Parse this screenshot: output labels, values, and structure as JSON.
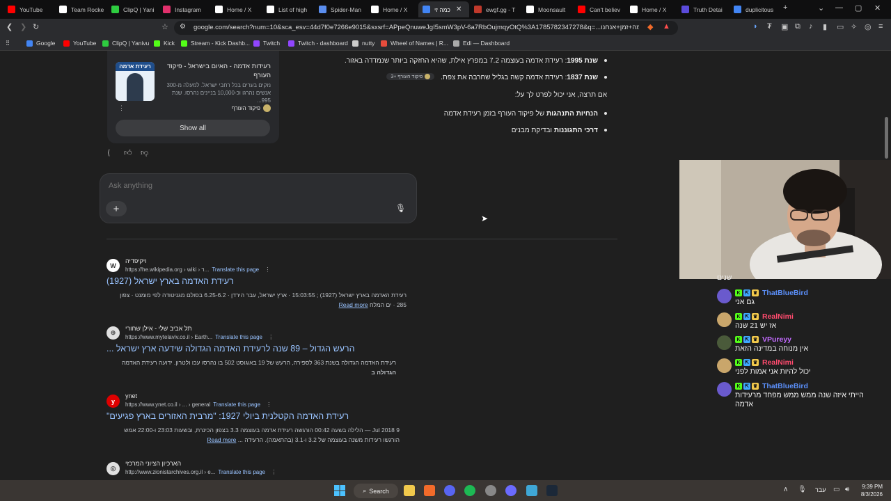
{
  "tabs": [
    {
      "title": "YouTube",
      "icon": "youtube-icon",
      "color": "#ff0000"
    },
    {
      "title": "Team Rocke",
      "icon": "docs-icon",
      "color": "#ffffff"
    },
    {
      "title": "ClipQ | Yani",
      "icon": "clipq-icon",
      "color": "#2ecc40"
    },
    {
      "title": "Instagram",
      "icon": "instagram-icon",
      "color": "#e1306c"
    },
    {
      "title": "Home / X",
      "icon": "x-icon",
      "color": "#ffffff"
    },
    {
      "title": "List of high",
      "icon": "wikipedia-icon",
      "color": "#ffffff"
    },
    {
      "title": "Spider-Man",
      "icon": "tab-icon",
      "color": "#5a8dee"
    },
    {
      "title": "Home / X",
      "icon": "x-icon",
      "color": "#ffffff"
    },
    {
      "title": "כמה זי",
      "icon": "google-icon",
      "color": "#4285f4",
      "active": true
    },
    {
      "title": "ewgf.gg - T",
      "icon": "ewgf-icon",
      "color": "#c0392b"
    },
    {
      "title": "Moonsault",
      "icon": "x-icon",
      "color": "#ffffff"
    },
    {
      "title": "Can't believ",
      "icon": "youtube-icon",
      "color": "#ff0000"
    },
    {
      "title": "Home / X",
      "icon": "x-icon",
      "color": "#ffffff"
    },
    {
      "title": "Truth Detai",
      "icon": "truth-icon",
      "color": "#5b4bdb"
    },
    {
      "title": "duplicitous",
      "icon": "google-icon",
      "color": "#4285f4"
    }
  ],
  "toolbar": {
    "url": "google.com/search?num=10&sca_esv=44d7f0e7266e9015&sxsrf=APpeQnuweJgI5smW3pV-6a7RbOujmqyOtQ%3A1785782347278&q=...כמה+זמן+אנחנו"
  },
  "bookmarks": [
    {
      "label": "Google",
      "color": "#4285f4"
    },
    {
      "label": "YouTube",
      "color": "#ff0000"
    },
    {
      "label": "ClipQ | Yanivu",
      "color": "#2ecc40"
    },
    {
      "label": "Kick",
      "color": "#53fc18"
    },
    {
      "label": "Stream - Kick Dashb...",
      "color": "#53fc18"
    },
    {
      "label": "Twitch",
      "color": "#9146ff"
    },
    {
      "label": "Twitch - dashboard",
      "color": "#9146ff"
    },
    {
      "label": "nutty",
      "color": "#cccccc"
    },
    {
      "label": "Wheel of Names | R...",
      "color": "#e74c3c"
    },
    {
      "label": "Edi — Dashboard",
      "color": "#aaaaaa"
    }
  ],
  "ai_overview": {
    "item1_year": "שנת 1995",
    "item1_text": ": רעידת אדמה בעוצמה 7.2 במפרץ אילת, שהיא החזקה ביותר שנמדדה באזור.",
    "item2_year": "שנת 1837",
    "item2_text": ": רעידת אדמה קשה בגליל שחרבה את צפת.",
    "source_chip": "פיקוד העורף +3",
    "intro": "אם תרצה, אני יכול לפרט לך על:",
    "option1_bold": "הנחיות התנהגות",
    "option1_rest": " של פיקוד העורף בזמן רעידת אדמה",
    "option2_bold": "דרכי התגוננות",
    "option2_rest": " ובדיקת מבנים"
  },
  "source_card": {
    "thumb_title": "רעידת אדמה",
    "title": "רעידות אדמה - האיום בישראל - פיקוד העורף",
    "snippet": "נזקים בערים בכל רחבי ישראל. למעלה מ-300 אנשים נהרגו וכ-10,000 בניינים נהרסו. שנת 995...",
    "source": "פיקוד העורף",
    "show_all": "Show all"
  },
  "ask": {
    "placeholder": "Ask anything"
  },
  "results": [
    {
      "site": "ויקיפדיה",
      "url": "https://he.wikipedia.org › wiki › ר...",
      "translate": "Translate this page",
      "title": "רעידת האדמה בארץ ישראל (1927)",
      "snippet1": "רעידת האדמה בארץ ישראל (1927) ; 15:03:55 · ארץ ישראל, עבר הירדן · 6.25-6.2 בסולם מגניטודה לפי מומנט · צפון",
      "snippet2": "285 · ים המלח",
      "readmore": "Read more",
      "icon_letter": "W",
      "icon_bg": "#ffffff",
      "icon_fg": "#333333"
    },
    {
      "site": "תל אביב שלי - אילן שחורי",
      "url": "https://www.mytelaviv.co.il › Earth...",
      "translate": "Translate this page",
      "title": "הרעש הגדול – 89 שנה לרעידת האדמה הגדולה שידעה ארץ ישראל ...",
      "snippet1": "רעידת האדמה הגדולה בשנת 363 לספירה, הרעש של 19 באוגוסט 502 בו נהרסו עכו ולטרון. ידועה רעידת האדמה",
      "snippet2": "הגדולה ב",
      "icon_letter": "⊕",
      "icon_bg": "#e0e0e0",
      "icon_fg": "#555555"
    },
    {
      "site": "ynet",
      "url": "https://www.ynet.co.il › ... › general",
      "translate": "Translate this page",
      "title": "רעידת האדמה הקטלנית ביולי 1927: \"מרבית האזורים בארץ פגיעים\"",
      "snippet1": "9 Jul 2018 — הלילה בשעה 00:42 הורגשה רעידת אדמה בעוצמה 3.3 בצפון הכינרת, ובשעות 23:03 ו-22:00 אמש",
      "snippet2": "הורגשו רעידות משנה בעוצמה של 3.2 ו-3.1 (בהתאמה). הרעידה ...",
      "readmore": "Read more",
      "icon_letter": "y",
      "icon_bg": "#de0000",
      "icon_fg": "#ffffff"
    },
    {
      "site": "הארכיון הציוני המרכזי",
      "url": "http://www.zionistarchives.org.il › e...",
      "translate": "Translate this page",
      "icon_letter": "◎",
      "icon_bg": "#e0e0e0",
      "icon_fg": "#555555"
    }
  ],
  "chat": {
    "partial": "שנים",
    "messages": [
      {
        "user": "ThatBlueBird",
        "color": "#5b8ff9",
        "text": "גם אני",
        "avatar": "#6a5acd"
      },
      {
        "user": "RealNimi",
        "color": "#ff4b6e",
        "text": "אז יש 21 שנה",
        "avatar": "#c9a66b"
      },
      {
        "user": "VPureyy",
        "color": "#c36bff",
        "text": "אין מנוחה במדינה הזאת",
        "avatar": "#4a5a3a"
      },
      {
        "user": "RealNimi",
        "color": "#ff4b6e",
        "text": "יכול להיות אני אמות לפני",
        "avatar": "#c9a66b"
      },
      {
        "user": "ThatBlueBird",
        "color": "#5b8ff9",
        "text": "הייתי איזה שנה ממש ממש מפחד מרעידות",
        "text2": "אדמה",
        "avatar": "#6a5acd"
      }
    ]
  },
  "taskbar": {
    "search": "Search",
    "lang": "עבר",
    "time": "9:39 PM",
    "date": "8/3/2026"
  }
}
